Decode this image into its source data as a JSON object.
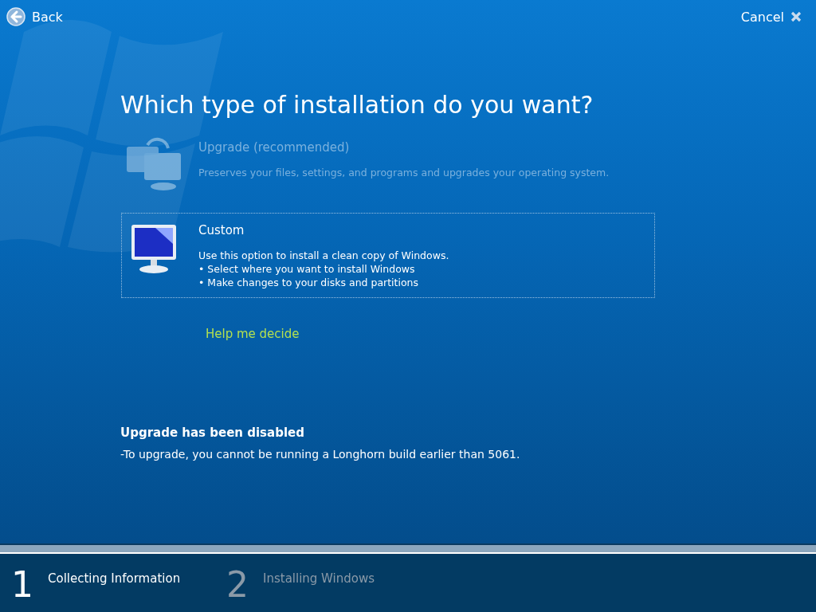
{
  "top_bar": {
    "back": "Back",
    "cancel": "Cancel"
  },
  "heading": "Which type of installation do you want?",
  "options": [
    {
      "title": "Upgrade (recommended)",
      "description": "Preserves your files, settings, and programs and upgrades your operating system.",
      "disabled": true,
      "selected": false
    },
    {
      "title": "Custom",
      "description": "Use this option to install a clean copy of Windows.",
      "bullets": [
        "• Select where you want to install Windows",
        "• Make changes to your disks and partitions"
      ],
      "disabled": false,
      "selected": true
    }
  ],
  "help_link": "Help me decide",
  "notice": {
    "title": "Upgrade has been disabled",
    "message": "-To upgrade, you cannot be running a Longhorn build earlier than 5061."
  },
  "progress": {
    "level": 1
  },
  "steps": [
    {
      "number": "1",
      "label": "Collecting Information",
      "selected": true
    },
    {
      "number": "2",
      "label": "Installing Windows",
      "selected": false
    }
  ]
}
